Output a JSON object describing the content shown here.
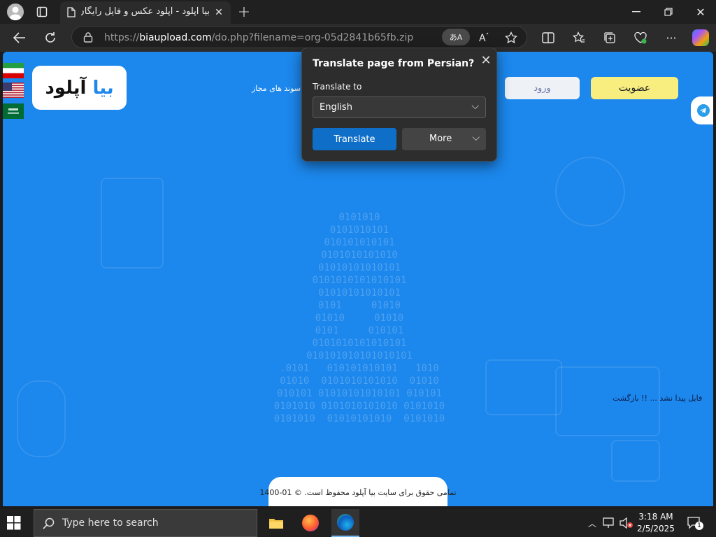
{
  "browser": {
    "tab_title": "بیا آپلود - آپلود عکس و فایل رایگان",
    "new_tab_symbol": "+",
    "url_prefix": "https://",
    "url_host": "biaupload.com",
    "url_path": "/do.php?filename=org-05d2841b65fb.zip"
  },
  "page": {
    "logo_part1": "بیا",
    "logo_part2": "آپلود",
    "login_label": "ورود",
    "signup_label": "عضویت",
    "nav_text": "سوند های مجاز",
    "return_link": "فایل پیدا نشد ... !! بازگشت",
    "footer_text": "تمامی حقوق برای سایت بیا آپلود محفوظ است. © 01-1400"
  },
  "translate_popup": {
    "title": "Translate page from Persian?",
    "translate_to_label": "Translate to",
    "selected_language": "English",
    "translate_button": "Translate",
    "more_button": "More"
  },
  "taskbar": {
    "search_placeholder": "Type here to search",
    "time": "3:18 AM",
    "date": "2/5/2025",
    "notification_count": "1"
  },
  "colors": {
    "page_bg": "#1c87ec",
    "signup_bg": "#f8ee80",
    "translate_btn": "#0e6ec8"
  }
}
